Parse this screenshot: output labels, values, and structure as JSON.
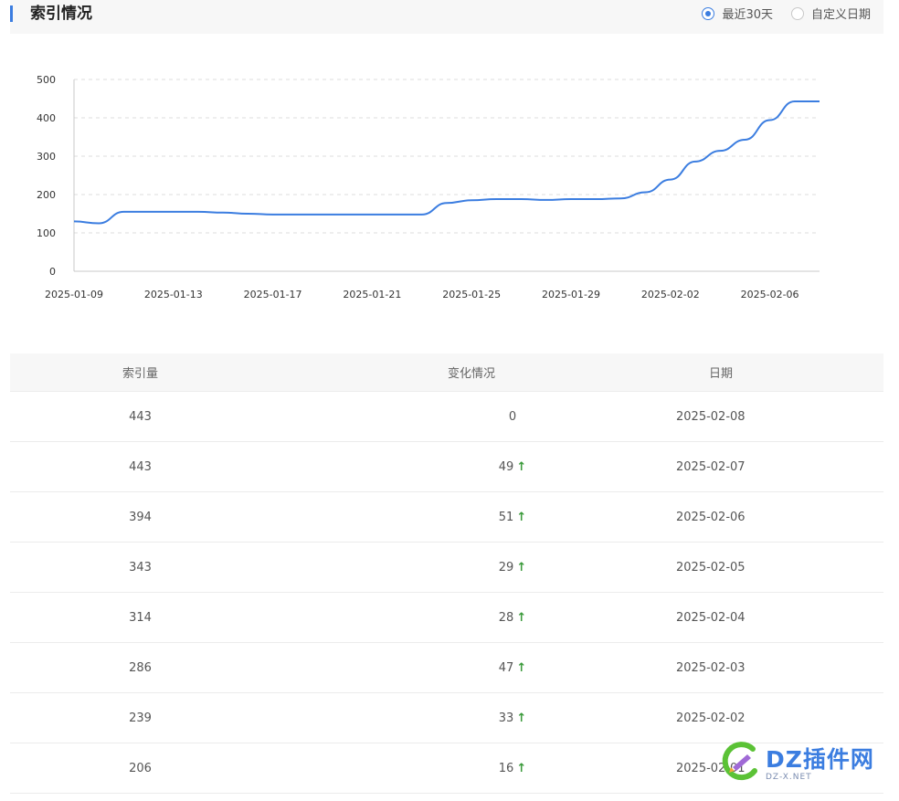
{
  "header": {
    "title": "索引情况",
    "options": [
      {
        "label": "最近30天",
        "checked": true
      },
      {
        "label": "自定义日期",
        "checked": false
      }
    ],
    "accent_color": "#3b7de0"
  },
  "chart_data": {
    "type": "line",
    "title": "",
    "xlabel": "",
    "ylabel": "",
    "ylim": [
      0,
      500
    ],
    "yticks": [
      0,
      100,
      200,
      300,
      400,
      500
    ],
    "xtick_labels": [
      "2025-01-09",
      "2025-01-13",
      "2025-01-17",
      "2025-01-21",
      "2025-01-25",
      "2025-01-29",
      "2025-02-02",
      "2025-02-06"
    ],
    "grid": "horizontal dashed",
    "color": "#3b7de0",
    "x": [
      "2025-01-09",
      "2025-01-10",
      "2025-01-11",
      "2025-01-12",
      "2025-01-13",
      "2025-01-14",
      "2025-01-15",
      "2025-01-16",
      "2025-01-17",
      "2025-01-18",
      "2025-01-19",
      "2025-01-20",
      "2025-01-21",
      "2025-01-22",
      "2025-01-23",
      "2025-01-24",
      "2025-01-25",
      "2025-01-26",
      "2025-01-27",
      "2025-01-28",
      "2025-01-29",
      "2025-01-30",
      "2025-01-31",
      "2025-02-01",
      "2025-02-02",
      "2025-02-03",
      "2025-02-04",
      "2025-02-05",
      "2025-02-06",
      "2025-02-07",
      "2025-02-08"
    ],
    "values": [
      130,
      125,
      155,
      155,
      155,
      155,
      153,
      150,
      148,
      148,
      148,
      148,
      148,
      148,
      148,
      178,
      185,
      188,
      188,
      186,
      188,
      188,
      190,
      206,
      239,
      286,
      314,
      343,
      394,
      443,
      443
    ]
  },
  "table": {
    "headers": [
      "索引量",
      "变化情况",
      "日期"
    ],
    "rows": [
      {
        "count": "443",
        "change": "0",
        "up": false,
        "date": "2025-02-08"
      },
      {
        "count": "443",
        "change": "49",
        "up": true,
        "date": "2025-02-07"
      },
      {
        "count": "394",
        "change": "51",
        "up": true,
        "date": "2025-02-06"
      },
      {
        "count": "343",
        "change": "29",
        "up": true,
        "date": "2025-02-05"
      },
      {
        "count": "314",
        "change": "28",
        "up": true,
        "date": "2025-02-04"
      },
      {
        "count": "286",
        "change": "47",
        "up": true,
        "date": "2025-02-03"
      },
      {
        "count": "239",
        "change": "33",
        "up": true,
        "date": "2025-02-02"
      },
      {
        "count": "206",
        "change": "16",
        "up": true,
        "date": "2025-02-01"
      }
    ],
    "up_arrow": "↑",
    "up_color": "#3a9a3a"
  },
  "watermark": {
    "text": "DZ插件网",
    "sub": "DZ-X.NET"
  }
}
